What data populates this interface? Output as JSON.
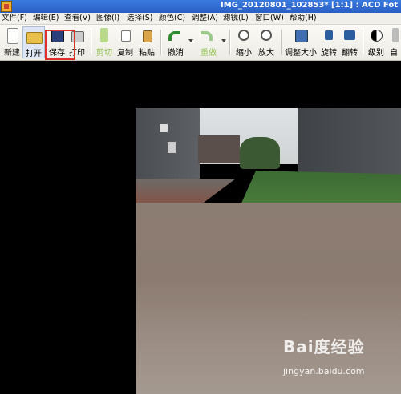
{
  "window": {
    "title": "IMG_20120801_102853* [1:1] : ACD Fot"
  },
  "menu": [
    {
      "label": "文件(F)"
    },
    {
      "label": "编辑(E)"
    },
    {
      "label": "查看(V)"
    },
    {
      "label": "图像(I)"
    },
    {
      "label": "选择(S)"
    },
    {
      "label": "颜色(C)"
    },
    {
      "label": "调整(A)"
    },
    {
      "label": "滤镜(L)"
    },
    {
      "label": "窗口(W)"
    },
    {
      "label": "帮助(H)"
    }
  ],
  "toolbar": {
    "buttons": [
      {
        "label": "新建",
        "icon": "new-file-icon",
        "enabled": true
      },
      {
        "label": "打开",
        "icon": "open-folder-icon",
        "enabled": true,
        "active": true
      },
      {
        "label": "保存",
        "icon": "floppy-disk-icon",
        "enabled": true,
        "highlighted": true
      },
      {
        "label": "打印",
        "icon": "printer-icon",
        "enabled": true
      },
      {
        "label": "剪切",
        "icon": "cut-icon",
        "enabled": false
      },
      {
        "label": "复制",
        "icon": "copy-icon",
        "enabled": true
      },
      {
        "label": "粘贴",
        "icon": "paste-icon",
        "enabled": true
      },
      {
        "label": "撤消",
        "icon": "undo-icon",
        "enabled": true
      },
      {
        "label": "重做",
        "icon": "redo-icon",
        "enabled": false
      },
      {
        "label": "缩小",
        "icon": "zoom-out-icon",
        "enabled": true
      },
      {
        "label": "放大",
        "icon": "zoom-in-icon",
        "enabled": true
      },
      {
        "label": "调整大小",
        "icon": "resize-icon",
        "enabled": true
      },
      {
        "label": "旋转",
        "icon": "rotate-icon",
        "enabled": true
      },
      {
        "label": "翻转",
        "icon": "flip-icon",
        "enabled": true
      },
      {
        "label": "级别",
        "icon": "levels-icon",
        "enabled": true
      },
      {
        "label": "自",
        "icon": "auto-icon",
        "enabled": true
      }
    ]
  },
  "watermark": {
    "logo": "Bai度经验",
    "url": "jingyan.baidu.com"
  },
  "colors": {
    "accent_red": "#e0302a",
    "titlebar_blue": "#2a5fc4",
    "disabled_green": "#8fbf4c"
  }
}
